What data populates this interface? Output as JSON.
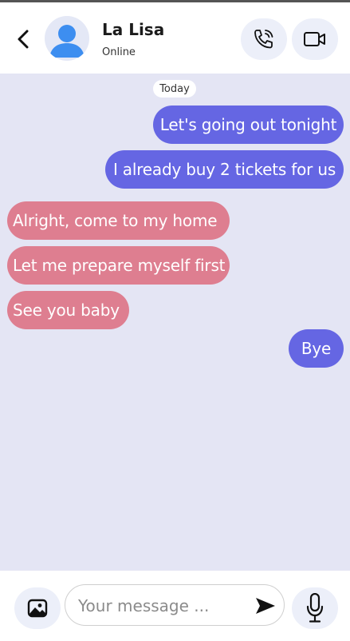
{
  "header": {
    "contact_name": "La Lisa",
    "status": "Online",
    "icons": {
      "back": "chevron-left-icon",
      "avatar": "user-avatar-icon",
      "call": "phone-call-icon",
      "video": "video-camera-icon"
    }
  },
  "chat": {
    "date_label": "Today",
    "messages": [
      {
        "direction": "outgoing",
        "text": "Let's going out tonight"
      },
      {
        "direction": "outgoing",
        "text": "I already buy 2 tickets for us"
      },
      {
        "direction": "incoming",
        "text": "Alright, come to my home"
      },
      {
        "direction": "incoming",
        "text": "Let me prepare myself first"
      },
      {
        "direction": "incoming",
        "text": "See you baby"
      },
      {
        "direction": "outgoing",
        "text": "Bye"
      }
    ]
  },
  "composer": {
    "placeholder": "Your message ...",
    "icons": {
      "image": "image-icon",
      "send": "send-icon",
      "mic": "microphone-icon"
    }
  },
  "colors": {
    "outgoing_bubble": "#6566e3",
    "incoming_bubble": "#de7e90",
    "chat_background": "#e4e5f4",
    "accent_button": "#eceff9",
    "avatar_blue": "#3d8ef0"
  }
}
